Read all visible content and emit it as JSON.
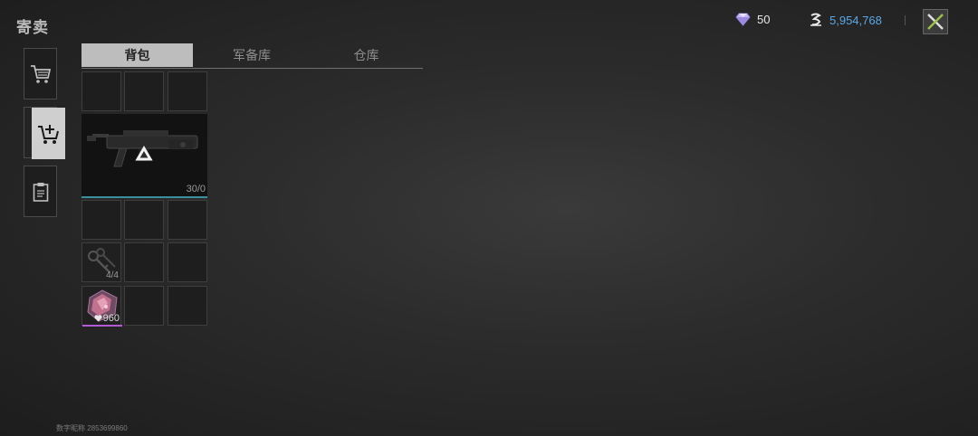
{
  "header": {
    "title": "寄卖"
  },
  "currency": {
    "gems": "50",
    "coins": "5,954,768",
    "coin_color": "#5aa8e6"
  },
  "sidebar": {
    "items": [
      {
        "icon": "shopping-cart-icon"
      },
      {
        "icon": "cart-add-icon"
      },
      {
        "icon": "clipboard-icon"
      }
    ]
  },
  "tabs": [
    {
      "label": "背包"
    },
    {
      "label": "军备库"
    },
    {
      "label": "仓库"
    }
  ],
  "inventory": {
    "weapon": {
      "ammo": "30/0",
      "rarity_color": "#3a8f9a"
    },
    "keys": {
      "count": "4/4"
    },
    "crystal": {
      "count": "960",
      "rarity_color": "#b25bd4"
    }
  },
  "footer": {
    "text": "数字昵称 2853699860"
  }
}
